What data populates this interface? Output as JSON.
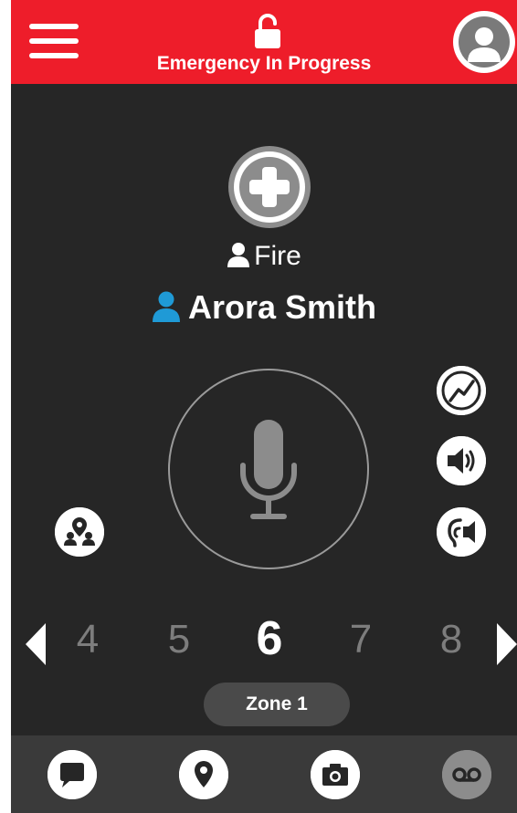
{
  "header": {
    "title": "Emergency In Progress"
  },
  "call": {
    "group_label": "Fire",
    "contact_name": "Arora Smith"
  },
  "channels": {
    "items": [
      "4",
      "5",
      "6",
      "7",
      "8"
    ],
    "active": "6"
  },
  "zone": {
    "label": "Zone 1"
  },
  "icons": {
    "menu": "hamburger-menu-icon",
    "lock": "unlocked-padlock-icon",
    "avatar": "user-avatar-icon",
    "add": "plus-icon",
    "group": "person-icon",
    "contact": "person-icon",
    "mic": "microphone-icon",
    "signal": "trend-line-icon",
    "speaker": "speaker-volume-icon",
    "earpiece": "earpiece-speaker-icon",
    "team": "team-location-icon",
    "prev": "triangle-left-icon",
    "next": "triangle-right-icon",
    "chat": "chat-bubble-icon",
    "location": "map-pin-icon",
    "camera": "camera-icon",
    "voicemail": "voicemail-icon"
  },
  "colors": {
    "header": "#ee1d2a",
    "background": "#262626",
    "bottom_bar": "#3a3a3a",
    "contact_icon": "#1f9ad6",
    "inactive_channel": "#7d7d7d"
  }
}
